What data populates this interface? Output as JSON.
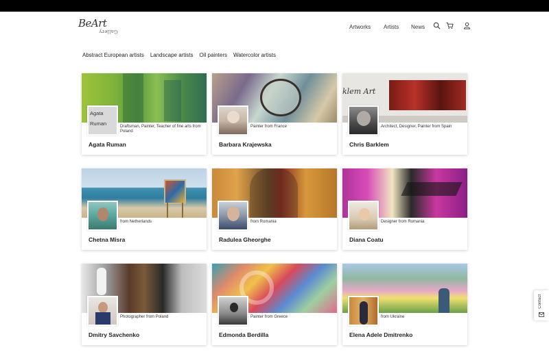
{
  "logo": {
    "script": "BeArt",
    "subtitle": "Gallery"
  },
  "nav": {
    "artworks": "Artworks",
    "artists": "Artists",
    "news": "News"
  },
  "categories": [
    "Abstract European artists",
    "Landscape artists",
    "Oil painters",
    "Watercolor artists"
  ],
  "artists": [
    {
      "name": "Agata Ruman",
      "description": "Draftsman, Painter, Teacher of fine arts from Poland",
      "avatar_alt": "Agata Ruman"
    },
    {
      "name": "Barbara Krajewska",
      "description": "Painter from France"
    },
    {
      "name": "Chris Barklem",
      "description": "Architect, Designer, Painter from Spain"
    },
    {
      "name": "Chetna Misra",
      "description": "from Netherlands"
    },
    {
      "name": "Radulea Gheorghe",
      "description": "from Romania"
    },
    {
      "name": "Diana Coatu",
      "description": "Designer from Romania"
    },
    {
      "name": "Dmitry Savchenko",
      "description": "Photographer from Poland"
    },
    {
      "name": "Edmonda Berdilla",
      "description": "Painter from Greece"
    },
    {
      "name": "Elena Adele Dmitrenko",
      "description": "from Ukraine"
    }
  ],
  "contact": {
    "label": "Contact"
  },
  "colors": {
    "accent": "#222222",
    "topbar": "#000000"
  },
  "icons": [
    "search-icon",
    "cart-icon",
    "user-icon",
    "mail-icon"
  ]
}
